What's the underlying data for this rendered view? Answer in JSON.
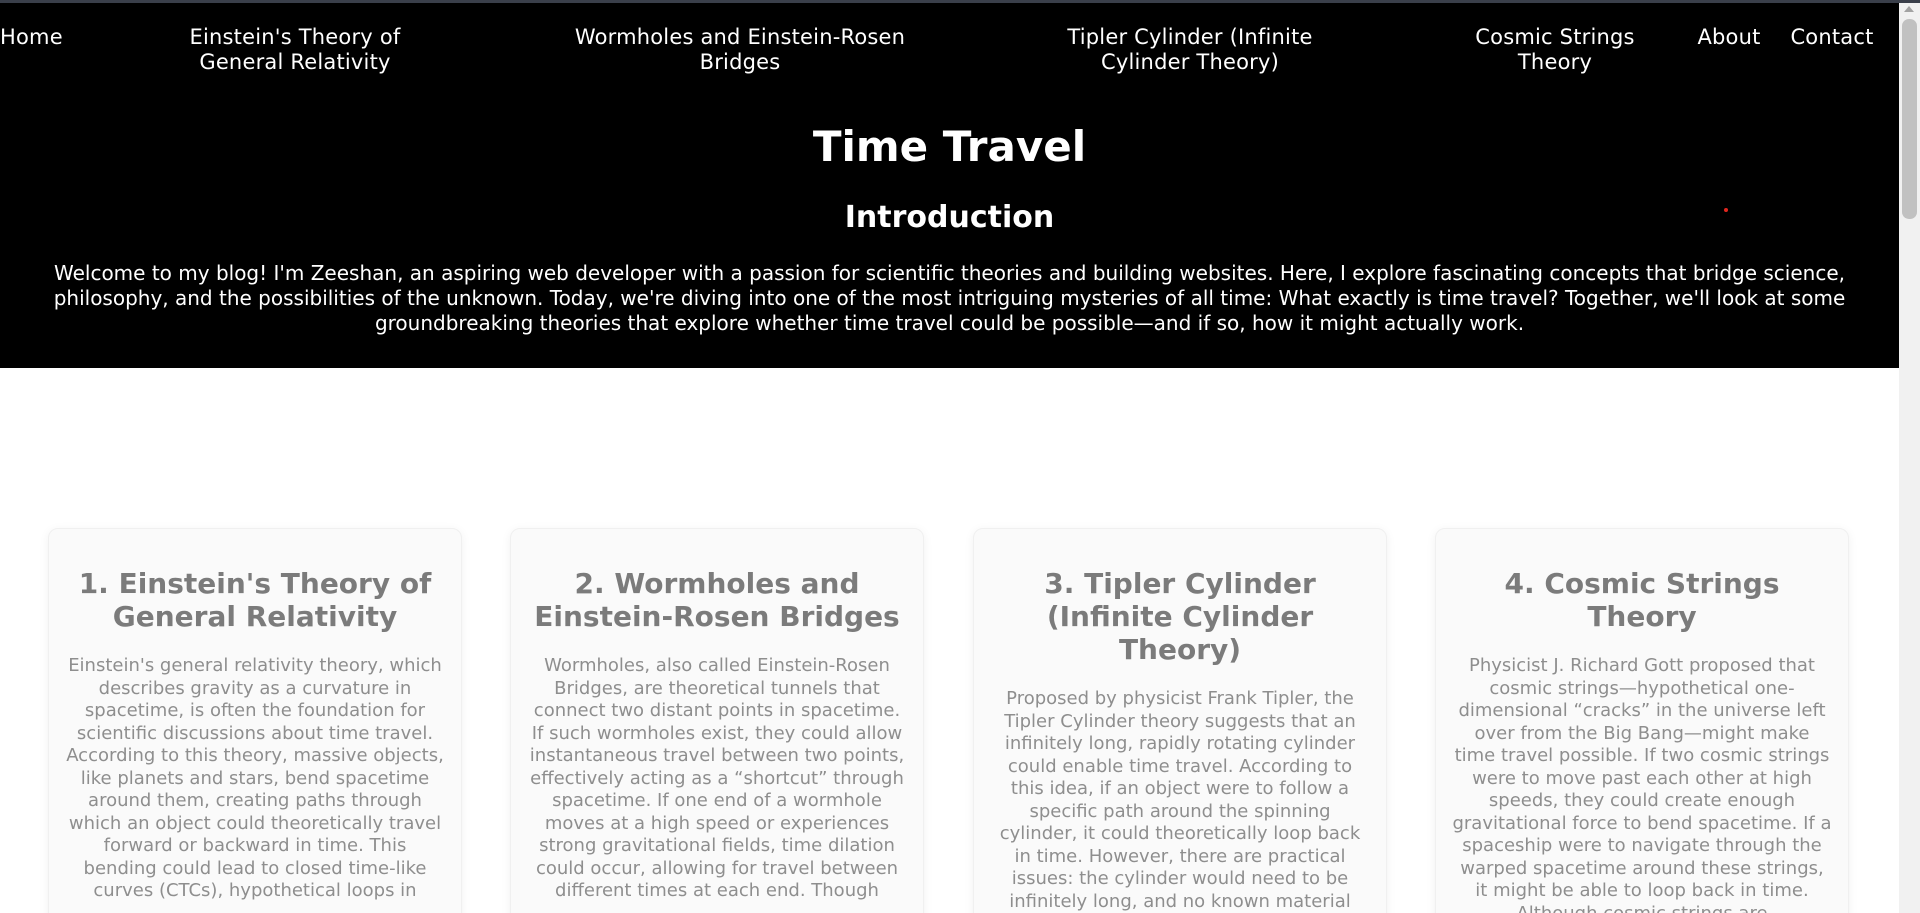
{
  "nav": {
    "home": "Home",
    "einstein": "Einstein's Theory of General Relativity",
    "wormholes": "Wormholes and Einstein-Rosen Bridges",
    "tipler": "Tipler Cylinder (Infinite Cylinder Theory)",
    "strings": "Cosmic Strings Theory",
    "about": "About",
    "contact": "Contact"
  },
  "hero": {
    "title": "Time Travel",
    "intro_heading": "Introduction",
    "intro_text": "Welcome to my blog! I'm Zeeshan, an aspiring web developer with a passion for scientific theories and building websites. Here, I explore fascinating concepts that bridge science, philosophy, and the possibilities of the unknown. Today, we're diving into one of the most intriguing mysteries of all time: What exactly is time travel? Together, we'll look at some groundbreaking theories that explore whether time travel could be possible—and if so, how it might actually work."
  },
  "cards": [
    {
      "title": "1. Einstein's Theory of General Relativity",
      "text": "Einstein's general relativity theory, which describes gravity as a curvature in spacetime, is often the foundation for scientific discussions about time travel. According to this theory, massive objects, like planets and stars, bend spacetime around them, creating paths through which an object could theoretically travel forward or backward in time. This bending could lead to closed time-like curves (CTCs), hypothetical loops in"
    },
    {
      "title": "2. Wormholes and Einstein-Rosen Bridges",
      "text": "Wormholes, also called Einstein-Rosen Bridges, are theoretical tunnels that connect two distant points in spacetime. If such wormholes exist, they could allow instantaneous travel between two points, effectively acting as a “shortcut” through spacetime. If one end of a wormhole moves at a high speed or experiences strong gravitational fields, time dilation could occur, allowing for travel between different times at each end. Though"
    },
    {
      "title": "3. Tipler Cylinder (Infinite Cylinder Theory)",
      "text": "Proposed by physicist Frank Tipler, the Tipler Cylinder theory suggests that an infinitely long, rapidly rotating cylinder could enable time travel. According to this idea, if an object were to follow a specific path around the spinning cylinder, it could theoretically loop back in time. However, there are practical issues: the cylinder would need to be infinitely long, and no known material could withstand the necessary rotational"
    },
    {
      "title": "4. Cosmic Strings Theory",
      "text": "Physicist J. Richard Gott proposed that cosmic strings—hypothetical one-dimensional “cracks” in the universe left over from the Big Bang—might make time travel possible. If two cosmic strings were to move past each other at high speeds, they could create enough gravitational force to bend spacetime. If a spaceship were to navigate through the warped spacetime around these strings, it might be able to loop back in time. Although cosmic strings are"
    }
  ],
  "colors": {
    "hero_bg": "#000000",
    "hero_text": "#ffffff",
    "card_bg": "#fafafa",
    "card_text": "#8a8a8a"
  }
}
